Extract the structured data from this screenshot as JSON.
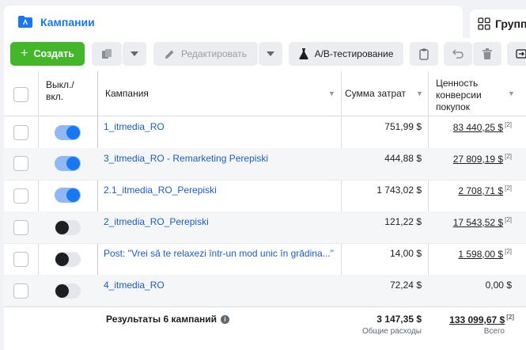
{
  "tabs": {
    "active_label": "Кампании",
    "inactive_label": "Группы"
  },
  "toolbar": {
    "create_label": "Создать",
    "edit_label": "Редактировать",
    "ab_label": "A/B-тестирование"
  },
  "table": {
    "headers": {
      "toggle": "Выкл./\nвкл.",
      "campaign": "Кампания",
      "spend": "Сумма затрат",
      "value": "Ценность\nконверсии\nпокупок"
    },
    "rows": [
      {
        "on": true,
        "name": "1_itmedia_RO",
        "spend": "751,99 $",
        "value": "83 440,25 $",
        "sup": "[2]",
        "underline": true
      },
      {
        "on": true,
        "name": "3_itmedia_RO - Remarketing Perepiski",
        "spend": "444,88 $",
        "value": "27 809,19 $",
        "sup": "[2]",
        "underline": true
      },
      {
        "on": true,
        "name": "2.1_itmedia_RO_Perepiski",
        "spend": "1 743,02 $",
        "value": "2 708,71 $",
        "sup": "[2]",
        "underline": true
      },
      {
        "on": false,
        "name": "2_itmedia_RO_Perepiski",
        "spend": "121,22 $",
        "value": "17 543,52 $",
        "sup": "[2]",
        "underline": true
      },
      {
        "on": false,
        "name": "Post: \"Vrei să te relaxezi într-un mod unic în grădina...\"",
        "spend": "14,00 $",
        "value": "1 598,00 $",
        "sup": "[2]",
        "underline": true
      },
      {
        "on": false,
        "name": "4_itmedia_RO",
        "spend": "72,24 $",
        "value": "0,00 $",
        "sup": "",
        "underline": false
      }
    ],
    "footer": {
      "label": "Результаты 6 кампаний",
      "spend": "3 147,35 $",
      "spend_sub": "Общие расходы",
      "value": "133 099,67 $",
      "value_sup": "[2]",
      "value_sub": "Всего"
    }
  },
  "colors": {
    "accent": "#1877f2",
    "create": "#42b72a",
    "link": "#1a5dc9"
  }
}
